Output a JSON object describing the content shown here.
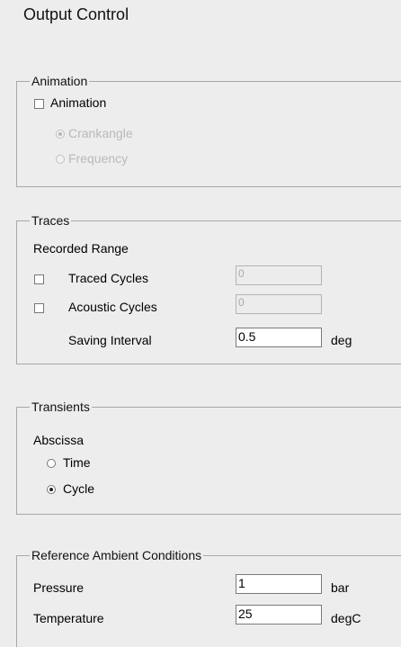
{
  "panel": {
    "title": "Output Control"
  },
  "animation": {
    "legend": "Animation",
    "checkbox_label": "Animation",
    "checkbox_checked": false,
    "options": [
      {
        "label": "Crankangle",
        "selected": true,
        "enabled": false
      },
      {
        "label": "Frequency",
        "selected": false,
        "enabled": false
      }
    ]
  },
  "traces": {
    "legend": "Traces",
    "recorded_range_label": "Recorded Range",
    "traced_cycles": {
      "label": "Traced Cycles",
      "checked": false,
      "value": "0"
    },
    "acoustic_cycles": {
      "label": "Acoustic Cycles",
      "checked": false,
      "value": "0"
    },
    "saving_interval": {
      "label": "Saving Interval",
      "value": "0.5",
      "unit": "deg"
    }
  },
  "transients": {
    "legend": "Transients",
    "abscissa_label": "Abscissa",
    "options": [
      {
        "label": "Time",
        "selected": false
      },
      {
        "label": "Cycle",
        "selected": true
      }
    ]
  },
  "reference": {
    "legend": "Reference Ambient Conditions",
    "pressure": {
      "label": "Pressure",
      "value": "1",
      "unit": "bar"
    },
    "temperature": {
      "label": "Temperature",
      "value": "25",
      "unit": "degC"
    }
  }
}
